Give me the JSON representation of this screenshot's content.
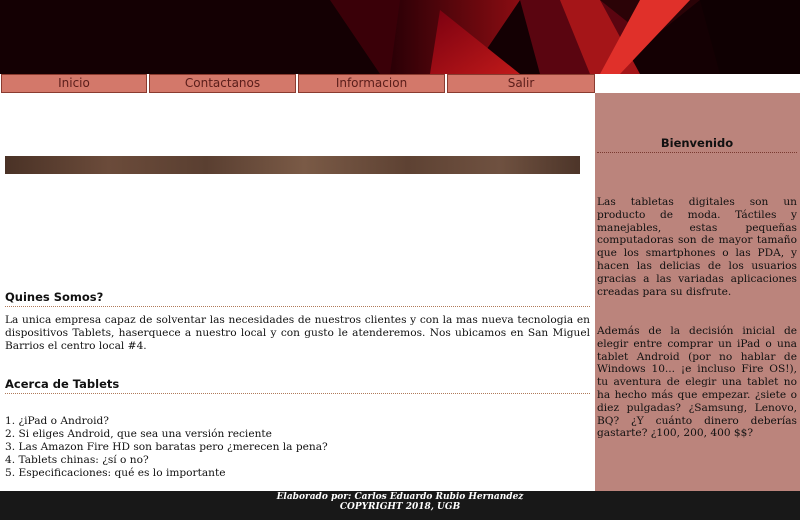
{
  "nav": {
    "items": [
      {
        "label": "Inicio"
      },
      {
        "label": "Contactanos"
      },
      {
        "label": "Informacion"
      },
      {
        "label": "Salir"
      }
    ]
  },
  "main": {
    "about_title": "Quines Somos?",
    "about_text": "La unica empresa capaz de solventar las necesidades de nuestros clientes y con la mas nueva tecnologia en dispositivos Tablets, haserquece a nuestro local y con gusto le atenderemos. Nos ubicamos en San Miguel Barrios el centro local #4.",
    "tablets_title": "Acerca de Tablets",
    "tablets_list": [
      "1. ¿iPad o Android?",
      "2. Si eliges Android, que sea una versión reciente",
      "3. Las Amazon Fire HD son baratas pero ¿merecen la pena?",
      "4. Tablets chinas: ¿sí o no?",
      "5. Especificaciones: qué es lo importante"
    ]
  },
  "sidebar": {
    "title": "Bienvenido",
    "paragraph1": "Las tabletas digitales son un producto de moda. Táctiles y manejables, estas pequeñas computadoras son de mayor tamaño que los smartphones o las PDA, y hacen las delicias de los usuarios gracias a las variadas aplicaciones creadas para su disfrute.",
    "paragraph2": "Además de la decisión inicial de elegir entre comprar un iPad o una tablet Android (por no hablar de Windows 10... ¡e incluso Fire OS!), tu aventura de elegir una tablet no ha hecho más que empezar. ¿siete o diez pulgadas? ¿Samsung, Lenovo, BQ? ¿Y cuánto dinero deberías gastarte? ¿100, 200, 400 $$?"
  },
  "footer": {
    "line1": "Elaborado por: Carlos Eduardo Rubio Hernandez",
    "line2": "COPYRIGHT 2018, UGB"
  },
  "colors": {
    "nav_button": "#d3786a",
    "sidebar_bg": "#bb847c",
    "footer_bg": "#181818",
    "banner_bg": "#150004"
  }
}
